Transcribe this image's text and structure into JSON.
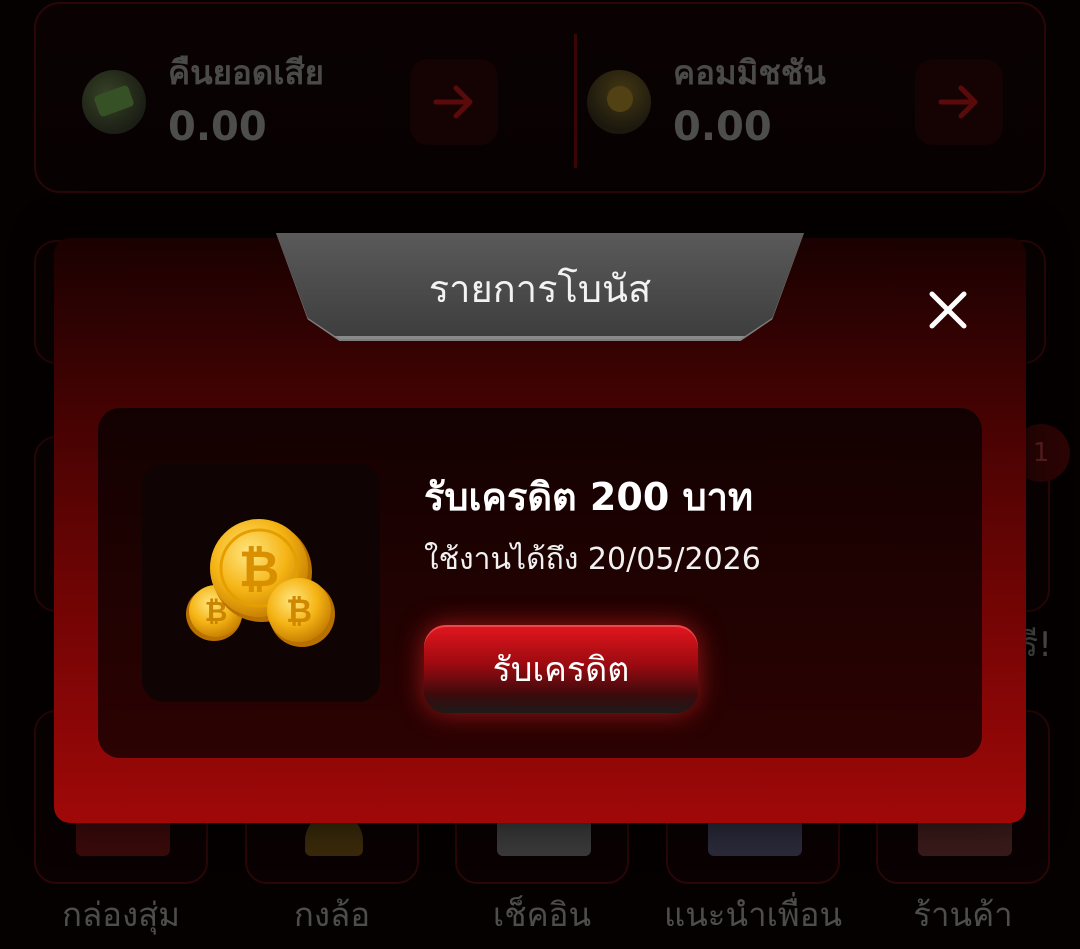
{
  "wallet": {
    "cashback": {
      "label": "คืนยอดเสีย",
      "value": "0.00",
      "icon": "money-cycle-icon"
    },
    "commission": {
      "label": "คอมมิชชัน",
      "value": "0.00",
      "icon": "coin-hand-icon"
    }
  },
  "badge": {
    "count": "1"
  },
  "edge_text": "รี!",
  "menu": [
    {
      "label": "กล่องสุ่ม",
      "icon": "gift-box-icon"
    },
    {
      "label": "กงล้อ",
      "icon": "wheel-icon"
    },
    {
      "label": "เช็คอิน",
      "icon": "calendar-icon"
    },
    {
      "label": "แนะนำเพื่อน",
      "icon": "friends-icon"
    },
    {
      "label": "ร้านค้า",
      "icon": "shop-icon"
    }
  ],
  "modal": {
    "title": "รายการโบนัส",
    "bonus": {
      "title": "รับเครดิต 200 บาท",
      "expiry": "ใช้งานได้ถึง 20/05/2026",
      "button_label": "รับเครดิต",
      "icon": "bitcoin-coins-icon"
    }
  },
  "colors": {
    "accent": "#e3161e",
    "modal_bottom": "#a00808",
    "background": "#050101"
  }
}
